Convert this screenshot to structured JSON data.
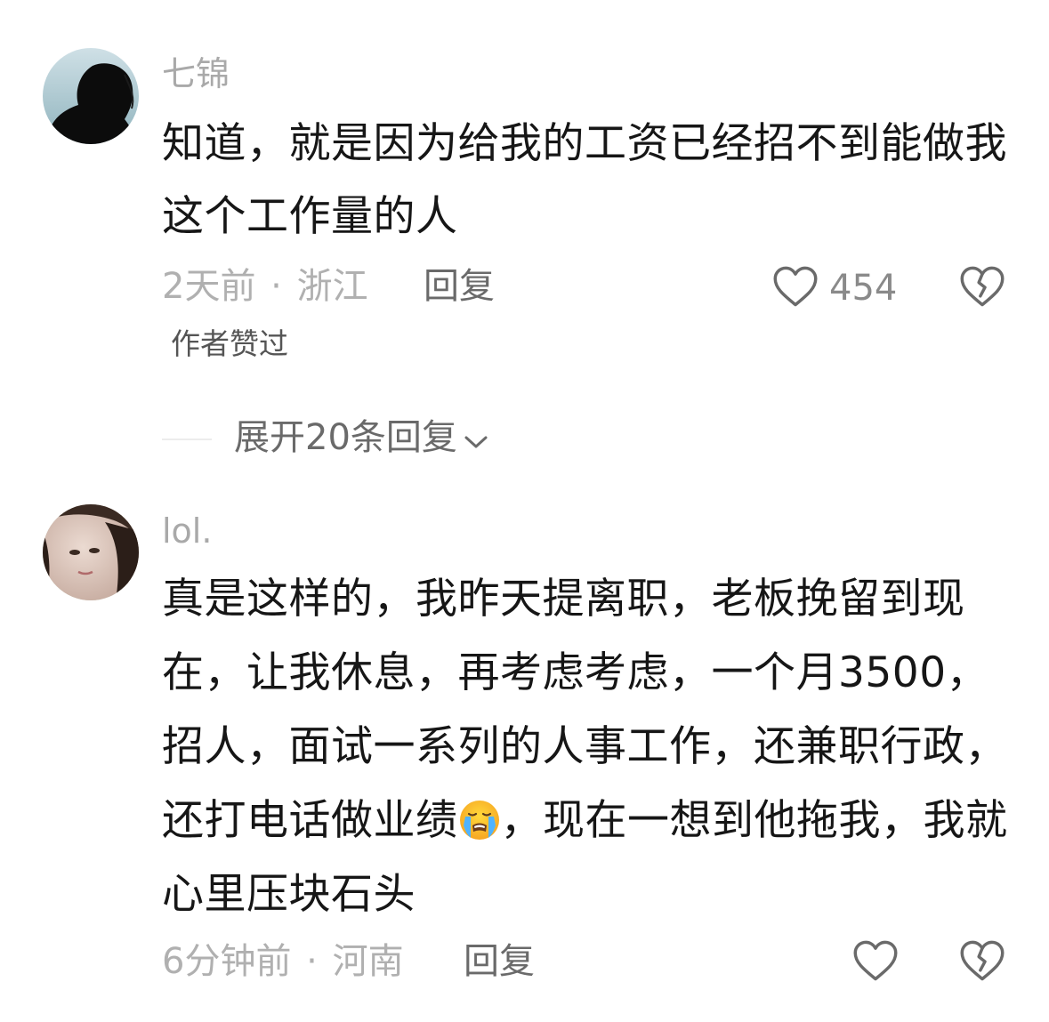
{
  "comments": [
    {
      "username": "七锦",
      "text": "知道，就是因为给我的工资已经招不到能做我这个工作量的人",
      "time": "2天前",
      "separator": "·",
      "location": "浙江",
      "reply_label": "回复",
      "like_count": "454",
      "author_liked_label": "作者赞过",
      "expand_replies_label": "展开20条回复"
    },
    {
      "username": "lol.",
      "text_before_emoji": "真是这样的，我昨天提离职，老板挽留到现在，让我休息，再考虑考虑，一个月3500，招人，面试一系列的人事工作，还兼职行政，还打电话做业绩",
      "emoji": "loudly-crying-face",
      "text_after_emoji": "，现在一想到他拖我，我就心里压块石头",
      "time": "6分钟前",
      "separator": "·",
      "location": "河南",
      "reply_label": "回复"
    }
  ],
  "icons": {
    "like": "heart-outline-icon",
    "dislike": "broken-heart-icon",
    "expand": "chevron-down-icon"
  },
  "colors": {
    "text_primary": "#161616",
    "text_muted": "#b0b0b0",
    "text_action": "#6a6a6a"
  }
}
